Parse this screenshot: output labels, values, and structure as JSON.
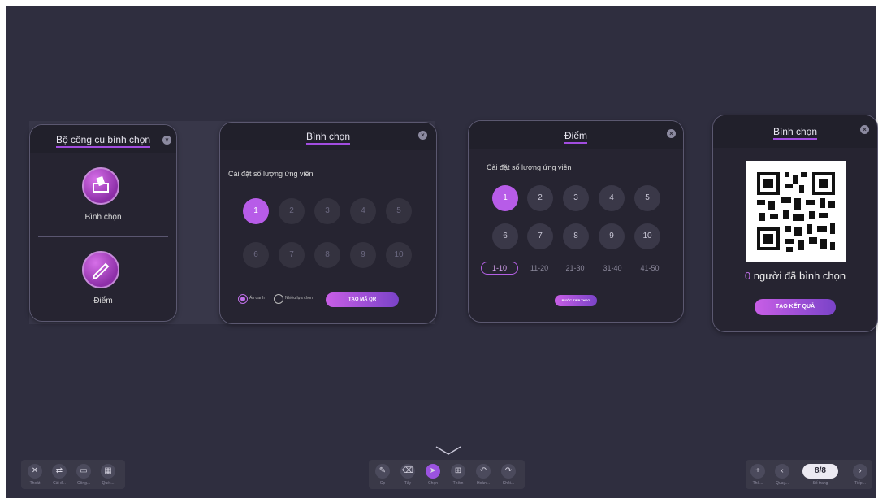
{
  "cards": {
    "tools": {
      "title": "Bộ công cụ bình chọn",
      "item1": "Bình chọn",
      "item2": "Điểm"
    },
    "vote": {
      "title": "Bình chọn",
      "subtitle": "Cài đặt số lượng ứng viên",
      "numbers": [
        "1",
        "2",
        "3",
        "4",
        "5",
        "6",
        "7",
        "8",
        "9",
        "10"
      ],
      "radio1": "Ẩn danh",
      "radio2": "Nhiều lựa chọn",
      "button": "TẠO MÃ QR"
    },
    "score": {
      "title": "Điểm",
      "subtitle": "Cài đặt số lượng ứng viên",
      "numbers": [
        "1",
        "2",
        "3",
        "4",
        "5",
        "6",
        "7",
        "8",
        "9",
        "10"
      ],
      "ranges": [
        "1-10",
        "11-20",
        "21-30",
        "31-40",
        "41-50"
      ],
      "button": "BƯỚC TIẾP THEO"
    },
    "result": {
      "title": "Bình chọn",
      "count": "0",
      "count_text": " người đã bình chọn",
      "button": "TẠO KẾT QUẢ"
    }
  },
  "bottom": {
    "left": [
      "Thoát",
      "Cài đ...",
      "Công...",
      "Quét..."
    ],
    "center": [
      "Cọ",
      "Tẩy",
      "Chọn",
      "Thêm",
      "Hoàn...",
      "Khôi..."
    ],
    "right": {
      "add": "Thê...",
      "prev": "Quay...",
      "page": "8/8",
      "page_label": "Số trang",
      "next": "Tiếp..."
    }
  }
}
